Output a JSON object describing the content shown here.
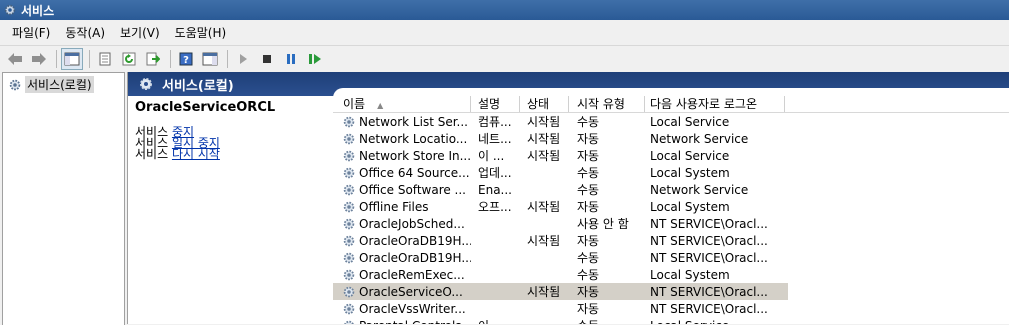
{
  "window": {
    "title": "서비스"
  },
  "menu": [
    "파일(F)",
    "동작(A)",
    "보기(V)",
    "도움말(H)"
  ],
  "toolbar": [
    "back-icon",
    "forward-icon",
    "show-console-tree-icon",
    "properties-icon",
    "refresh-icon",
    "export-list-icon",
    "help-icon",
    "show-action-pane-icon",
    "start-service-icon",
    "stop-service-icon",
    "pause-service-icon",
    "restart-service-icon"
  ],
  "tree": {
    "item": "서비스(로컬)"
  },
  "main": {
    "header": "서비스(로컬)",
    "selected_name": "OracleServiceORCL",
    "actions": [
      {
        "prefix": "서비스 ",
        "link": "중지"
      },
      {
        "prefix": "서비스 ",
        "link": "일시 중지"
      },
      {
        "prefix": "서비스 ",
        "link": "다시 시작"
      }
    ]
  },
  "table": {
    "columns": [
      "이름",
      "설명",
      "상태",
      "시작 유형",
      "다음 사용자로 로그온"
    ],
    "sort_indicator": "▲",
    "rows": [
      {
        "name": "Network List Ser...",
        "desc": "컴퓨...",
        "status": "시작됨",
        "start": "수동",
        "logon": "Local Service"
      },
      {
        "name": "Network Locatio...",
        "desc": "네트...",
        "status": "시작됨",
        "start": "자동",
        "logon": "Network Service"
      },
      {
        "name": "Network Store In...",
        "desc": "이 ...",
        "status": "시작됨",
        "start": "자동",
        "logon": "Local Service"
      },
      {
        "name": "Office 64 Source...",
        "desc": "업데...",
        "status": "",
        "start": "수동",
        "logon": "Local System"
      },
      {
        "name": "Office Software ...",
        "desc": "Ena...",
        "status": "",
        "start": "수동",
        "logon": "Network Service"
      },
      {
        "name": "Offline Files",
        "desc": "오프...",
        "status": "시작됨",
        "start": "자동",
        "logon": "Local System"
      },
      {
        "name": "OracleJobSched...",
        "desc": "",
        "status": "",
        "start": "사용 안 함",
        "logon": "NT SERVICE\\Oracl..."
      },
      {
        "name": "OracleOraDB19H...",
        "desc": "",
        "status": "시작됨",
        "start": "자동",
        "logon": "NT SERVICE\\Oracl..."
      },
      {
        "name": "OracleOraDB19H...",
        "desc": "",
        "status": "",
        "start": "수동",
        "logon": "NT SERVICE\\Oracl..."
      },
      {
        "name": "OracleRemExec...",
        "desc": "",
        "status": "",
        "start": "수동",
        "logon": "Local System"
      },
      {
        "name": "OracleServiceO...",
        "desc": "",
        "status": "시작됨",
        "start": "자동",
        "logon": "NT SERVICE\\Oracl...",
        "selected": true
      },
      {
        "name": "OracleVssWriter...",
        "desc": "",
        "status": "",
        "start": "자동",
        "logon": "NT SERVICE\\Oracl..."
      },
      {
        "name": "Parental Controls",
        "desc": "이 ...",
        "status": "",
        "start": "수동",
        "logon": "Local Service"
      }
    ]
  }
}
